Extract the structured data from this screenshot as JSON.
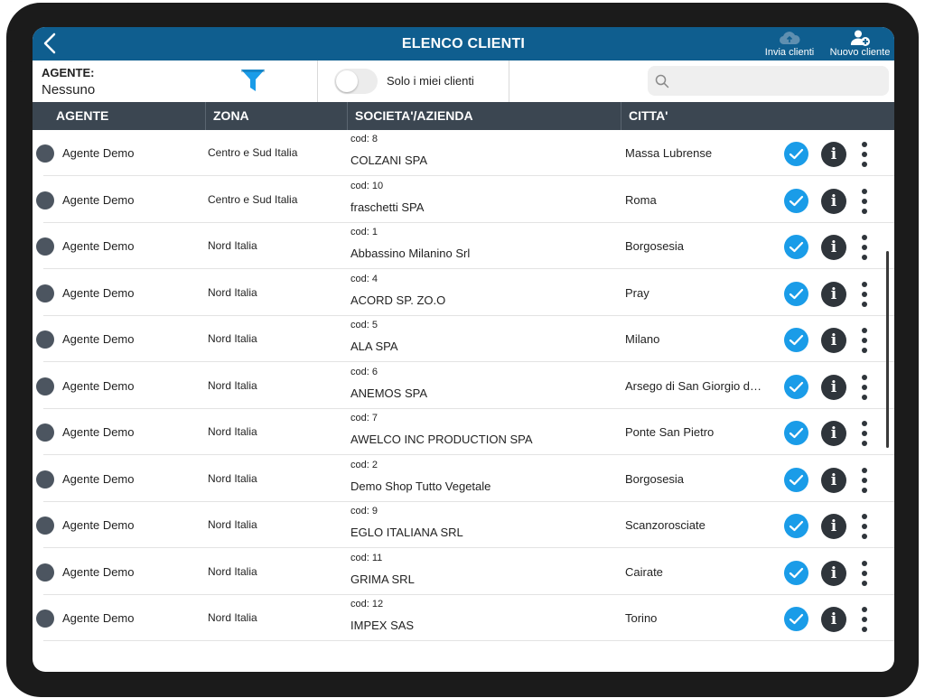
{
  "header": {
    "title": "ELENCO CLIENTI",
    "send_label": "Invia clienti",
    "new_label": "Nuovo cliente"
  },
  "filters": {
    "agent_label": "AGENTE:",
    "agent_value": "Nessuno",
    "toggle_label": "Solo i miei clienti",
    "toggle_on": false,
    "search_placeholder": ""
  },
  "columns": [
    "AGENTE",
    "ZONA",
    "SOCIETA'/AZIENDA",
    "CITTA'"
  ],
  "colors": {
    "header_bg": "#0f5e8f",
    "table_header_bg": "#3b4651",
    "accent": "#1a9ce8",
    "filter_icon": "#1a9ce8"
  },
  "icons": [
    "back-icon",
    "cloud-upload-icon",
    "add-user-icon",
    "filter-icon",
    "search-icon",
    "check-icon",
    "info-icon",
    "more-vertical-icon"
  ],
  "rows": [
    {
      "agent": "Agente Demo",
      "zona": "Centro e Sud Italia",
      "cod": "cod: 8",
      "societa": "COLZANI SPA",
      "citta": "Massa Lubrense"
    },
    {
      "agent": "Agente Demo",
      "zona": "Centro e Sud Italia",
      "cod": "cod: 10",
      "societa": "fraschetti SPA",
      "citta": "Roma"
    },
    {
      "agent": "Agente Demo",
      "zona": "Nord Italia",
      "cod": "cod: 1",
      "societa": "Abbassino Milanino Srl",
      "citta": "Borgosesia"
    },
    {
      "agent": "Agente Demo",
      "zona": "Nord Italia",
      "cod": "cod: 4",
      "societa": "ACORD SP. ZO.O",
      "citta": "Pray"
    },
    {
      "agent": "Agente Demo",
      "zona": "Nord Italia",
      "cod": "cod: 5",
      "societa": "ALA SPA",
      "citta": "Milano"
    },
    {
      "agent": "Agente Demo",
      "zona": "Nord Italia",
      "cod": "cod: 6",
      "societa": "ANEMOS SPA",
      "citta": "Arsego di San Giorgio d…"
    },
    {
      "agent": "Agente Demo",
      "zona": "Nord Italia",
      "cod": "cod: 7",
      "societa": "AWELCO INC PRODUCTION SPA",
      "citta": "Ponte San Pietro"
    },
    {
      "agent": "Agente Demo",
      "zona": "Nord Italia",
      "cod": "cod: 2",
      "societa": "Demo Shop Tutto Vegetale",
      "citta": "Borgosesia"
    },
    {
      "agent": "Agente Demo",
      "zona": "Nord Italia",
      "cod": "cod: 9",
      "societa": "EGLO ITALIANA SRL",
      "citta": "Scanzorosciate"
    },
    {
      "agent": "Agente Demo",
      "zona": "Nord Italia",
      "cod": "cod: 11",
      "societa": "GRIMA SRL",
      "citta": "Cairate"
    },
    {
      "agent": "Agente Demo",
      "zona": "Nord Italia",
      "cod": "cod: 12",
      "societa": "IMPEX SAS",
      "citta": "Torino"
    }
  ]
}
